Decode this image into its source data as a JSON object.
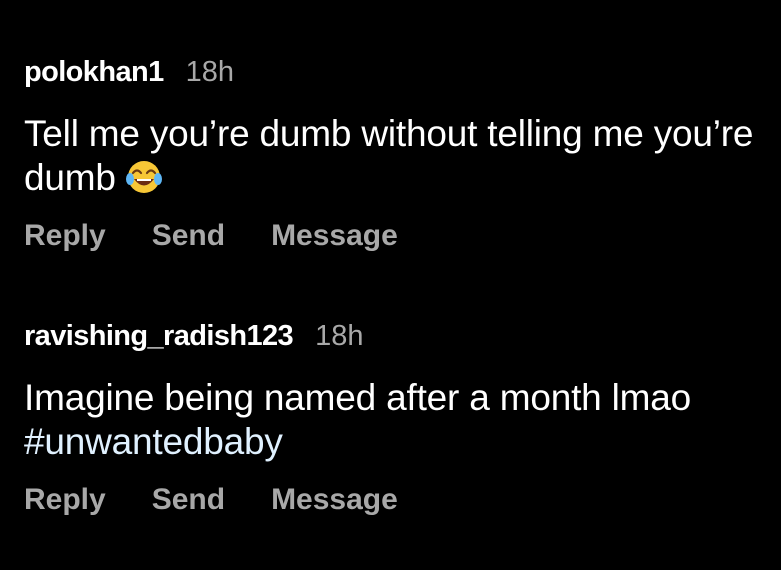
{
  "comments": [
    {
      "username": "polokhan1",
      "time": "18h",
      "text": "Tell me you’re dumb without telling me you’re dumb",
      "emoji": "face-with-tears-of-joy-icon",
      "actions": {
        "reply": "Reply",
        "send": "Send",
        "message": "Message"
      }
    },
    {
      "username": "ravishing_radish123",
      "time": "18h",
      "text": "Imagine being named after a month lmao",
      "hashtag": "#unwantedbaby",
      "actions": {
        "reply": "Reply",
        "send": "Send",
        "message": "Message"
      }
    }
  ],
  "colors": {
    "background": "#000000",
    "primary_text": "#ffffff",
    "secondary_text": "#a8a8a8",
    "hashtag": "#e0f1ff"
  }
}
